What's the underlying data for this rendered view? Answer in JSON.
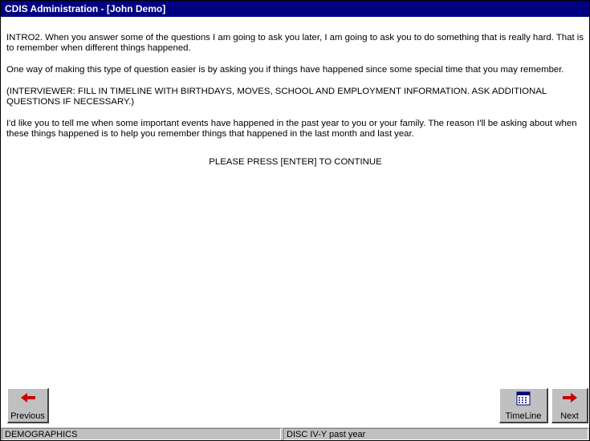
{
  "window": {
    "title": "CDIS Administration - [John Demo]"
  },
  "content": {
    "paragraphs": [
      "INTRO2. When you answer some of the questions I am going to ask you later, I am going to ask you to do something that is really hard. That is to remember when different things happened.",
      "One way of making this type of question easier is by asking you if things have happened since some special time that you may remember.",
      "(INTERVIEWER: FILL IN TIMELINE WITH BIRTHDAYS, MOVES, SCHOOL AND EMPLOYMENT INFORMATION. ASK ADDITIONAL QUESTIONS IF NECESSARY.)",
      "I'd like you to tell me when some important events have happened in the past year to you or your family. The reason I'll be asking about when these things happened is to help you remember things that happened in the last month and last year."
    ],
    "prompt": "PLEASE PRESS [ENTER] TO CONTINUE"
  },
  "buttons": {
    "previous": {
      "label": "Previous",
      "icon": "arrow-left-icon"
    },
    "timeline": {
      "label": "TimeLine",
      "icon": "calendar-icon"
    },
    "next": {
      "label": "Next",
      "icon": "arrow-right-icon"
    }
  },
  "status": {
    "section": "DEMOGRAPHICS",
    "module": "DISC IV-Y past year"
  },
  "colors": {
    "titlebar": "#000080",
    "arrow": "#cc0000",
    "face": "#c0c0c0"
  }
}
